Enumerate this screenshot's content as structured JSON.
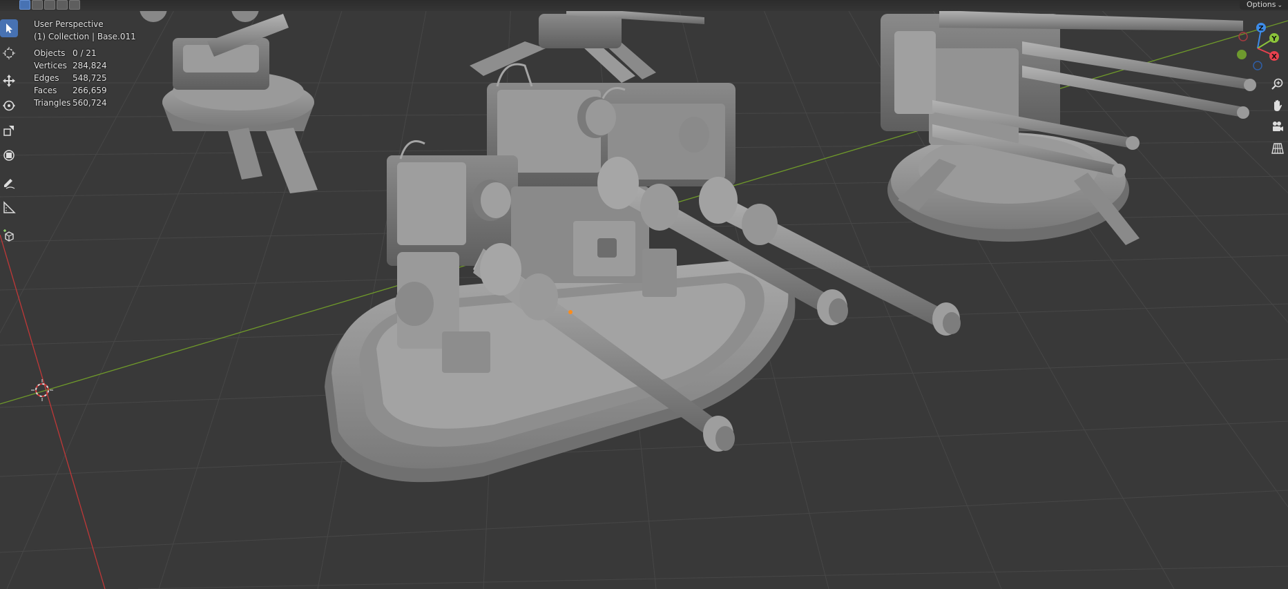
{
  "app": "Blender",
  "header": {
    "options_label": "Options"
  },
  "overlay": {
    "view_name": "User Perspective",
    "collection_info": "(1) Collection | Base.011",
    "stats": [
      {
        "label": "Objects",
        "value": "0 / 21"
      },
      {
        "label": "Vertices",
        "value": "284,824"
      },
      {
        "label": "Edges",
        "value": "548,725"
      },
      {
        "label": "Faces",
        "value": "266,659"
      },
      {
        "label": "Triangles",
        "value": "560,724"
      }
    ]
  },
  "toolbar": {
    "tools": [
      {
        "name": "select-box",
        "icon": "select-box-icon",
        "active": true
      },
      {
        "name": "cursor",
        "icon": "cursor-icon",
        "active": false
      },
      {
        "name": "move",
        "icon": "move-icon",
        "active": false
      },
      {
        "name": "rotate",
        "icon": "rotate-icon",
        "active": false
      },
      {
        "name": "scale",
        "icon": "scale-icon",
        "active": false
      },
      {
        "name": "transform",
        "icon": "transform-icon",
        "active": false
      },
      {
        "name": "annotate",
        "icon": "annotate-icon",
        "active": false
      },
      {
        "name": "measure",
        "icon": "measure-icon",
        "active": false
      },
      {
        "name": "add-cube",
        "icon": "add-cube-icon",
        "active": false
      }
    ]
  },
  "gizmo": {
    "axis_z": "Z",
    "axis_y": "Y",
    "axis_x": "X",
    "colors": {
      "x": "#e8414e",
      "y": "#8bc43a",
      "z": "#3d8be8"
    }
  },
  "nav_buttons": [
    {
      "name": "zoom",
      "icon": "zoom-icon"
    },
    {
      "name": "pan",
      "icon": "hand-icon"
    },
    {
      "name": "camera",
      "icon": "camera-icon"
    },
    {
      "name": "ortho",
      "icon": "grid-perspective-icon"
    }
  ],
  "scene": {
    "background": "#393939",
    "grid_color": "#454545",
    "x_axis_color": "#c03838",
    "y_axis_color": "#6f9a2a",
    "model_color": "#8c8c8c"
  }
}
